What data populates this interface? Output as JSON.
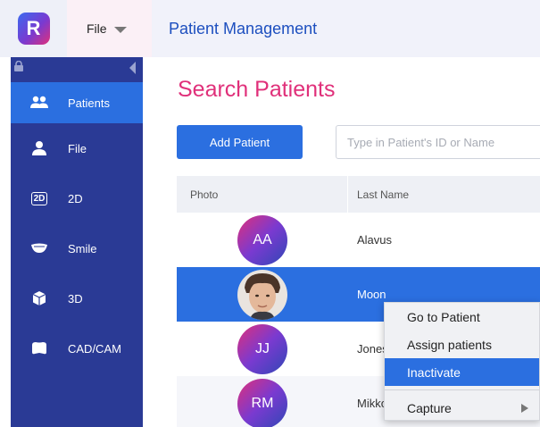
{
  "app": {
    "logo_letter": "R",
    "file_menu": "File",
    "title": "Patient Management"
  },
  "sidebar": {
    "items": [
      {
        "label": "Patients",
        "icon": "patients-icon",
        "active": true
      },
      {
        "label": "File",
        "icon": "person-icon"
      },
      {
        "label": "2D",
        "icon": "2d-icon",
        "icon_text": "2D"
      },
      {
        "label": "Smile",
        "icon": "smile-icon"
      },
      {
        "label": "3D",
        "icon": "3d-cube-icon"
      },
      {
        "label": "CAD/CAM",
        "icon": "cadcam-tooth-icon"
      }
    ]
  },
  "main": {
    "heading": "Search Patients",
    "add_button": "Add Patient",
    "search_placeholder": "Type in Patient's ID or Name"
  },
  "table": {
    "columns": [
      "Photo",
      "Last Name"
    ],
    "rows": [
      {
        "initials": "AA",
        "last_name": "Alavus"
      },
      {
        "initials": "",
        "last_name": "Moon",
        "photo": true,
        "selected": true
      },
      {
        "initials": "JJ",
        "last_name": "Jones"
      },
      {
        "initials": "RM",
        "last_name": "Mikko"
      }
    ]
  },
  "context_menu": {
    "items": [
      "Go to Patient",
      "Assign patients",
      "Inactivate",
      "Capture"
    ],
    "highlighted": "Inactivate"
  },
  "colors": {
    "accent": "#2b6fe0",
    "sidebar": "#2a3a95",
    "heading": "#e0307a"
  }
}
